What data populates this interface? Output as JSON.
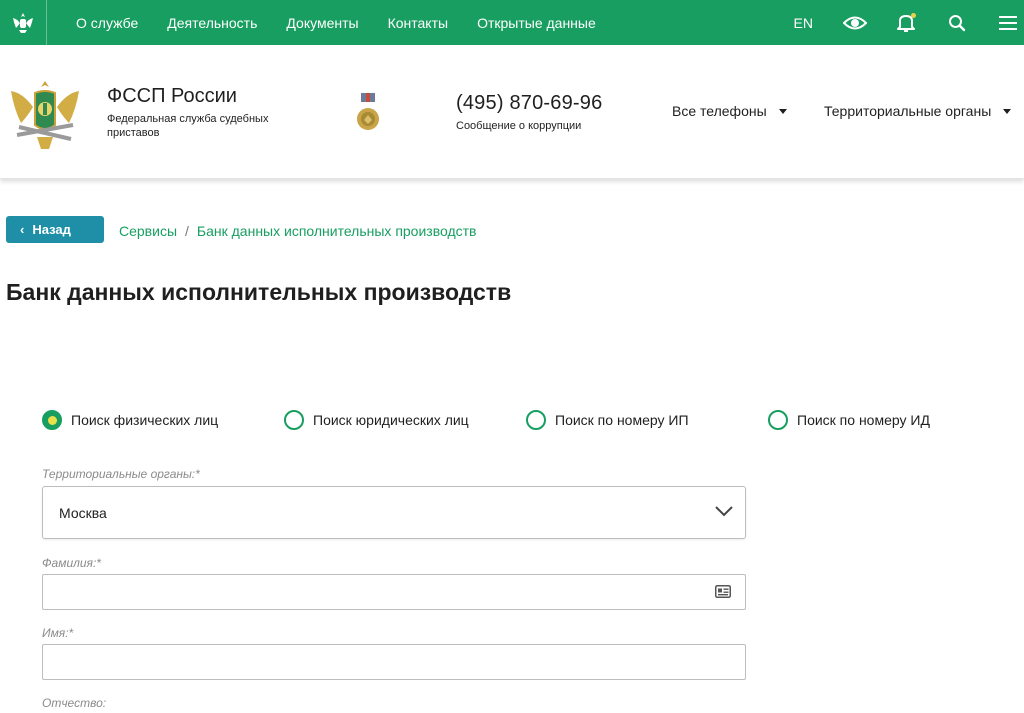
{
  "nav": {
    "items": [
      "О службе",
      "Деятельность",
      "Документы",
      "Контакты",
      "Открытые данные"
    ],
    "lang": "EN",
    "icons": [
      "eye-icon",
      "bell-icon",
      "search-icon",
      "menu-icon"
    ]
  },
  "header": {
    "org_name": "ФССП России",
    "org_subtitle": "Федеральная служба судебных приставов",
    "phone": "(495) 870-69-96",
    "phone_caption": "Сообщение о коррупции",
    "phones_dropdown": "Все телефоны",
    "territorial_dropdown": "Территориальные органы"
  },
  "breadcrumb": {
    "back_label": "Назад",
    "items": [
      "Сервисы",
      "Банк данных исполнительных производств"
    ]
  },
  "page_title": "Банк данных исполнительных производств",
  "search_modes": {
    "options": [
      "Поиск физических лиц",
      "Поиск юридических лиц",
      "Поиск по номеру ИП",
      "Поиск по номеру ИД"
    ],
    "selected": "Поиск физических лиц"
  },
  "form": {
    "region_label": "Территориальные органы:*",
    "region_value": "Москва",
    "last_name_label": "Фамилия:*",
    "last_name_value": "",
    "first_name_label": "Имя:*",
    "first_name_value": "",
    "patronymic_label": "Отчество:"
  },
  "colors": {
    "brand_green": "#179e60",
    "back_button": "#1f8fa8",
    "radio_dot": "#e9e04b"
  }
}
